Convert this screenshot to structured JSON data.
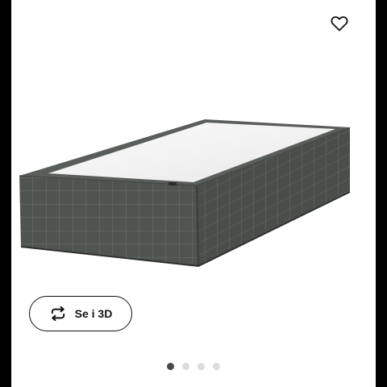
{
  "product": {
    "image_icon": "box-spring-bed-image"
  },
  "actions": {
    "favorite_icon": "heart-outline-icon",
    "view_3d_label": "Se i 3D",
    "view_3d_icon": "rotate-arrows-icon"
  },
  "gallery": {
    "image_count": 4,
    "active_index": 1
  },
  "colors": {
    "fabric": "#505450",
    "fabric_dark": "#3a3d3a",
    "active_dot": "#484848",
    "inactive_dot": "#dcdcdc"
  }
}
